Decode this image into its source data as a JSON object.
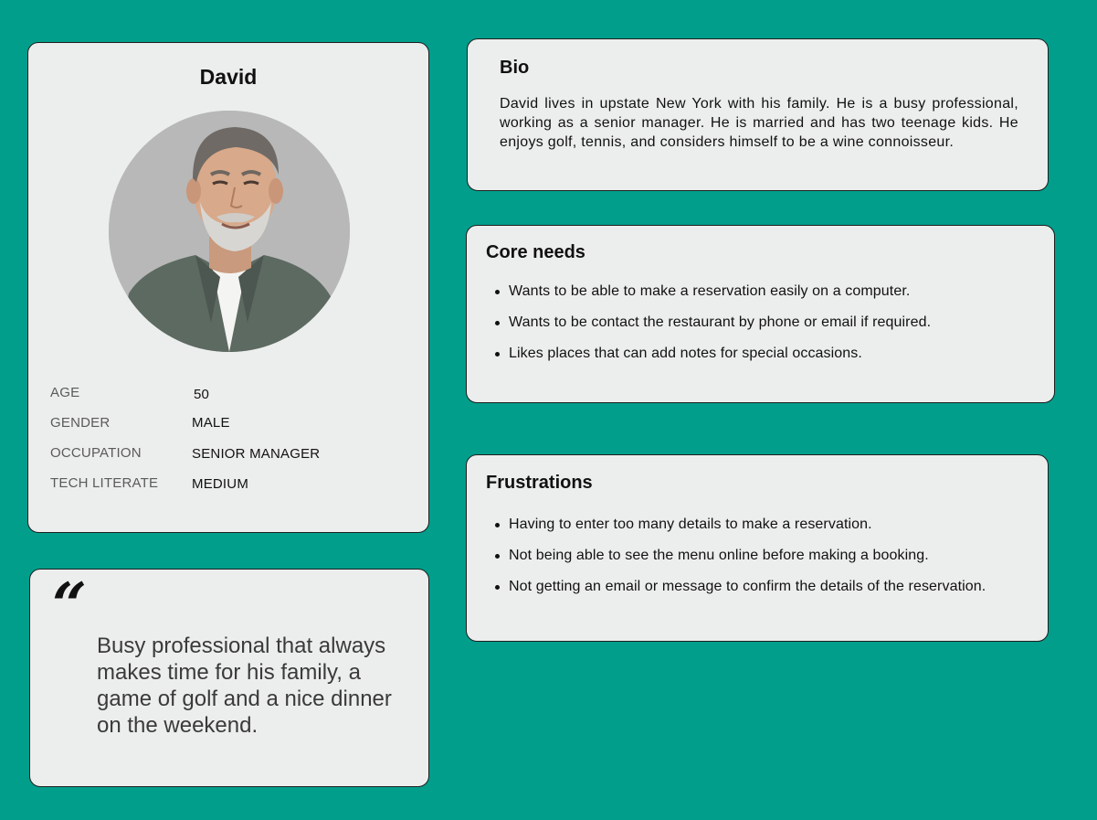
{
  "profile": {
    "name": "David",
    "attributes": [
      {
        "label": "AGE",
        "value": "50"
      },
      {
        "label": "GENDER",
        "value": "MALE"
      },
      {
        "label": "OCCUPATION",
        "value": "SENIOR MANAGER"
      },
      {
        "label": "TECH LITERATE",
        "value": "MEDIUM"
      }
    ]
  },
  "quote": {
    "mark": "“",
    "text": "Busy professional that always makes time for his family, a game of golf and a nice dinner on the weekend."
  },
  "bio": {
    "title": "Bio",
    "text": "David lives in upstate New York with his family. He is a busy professional, working as a senior manager. He is married and has two teenage kids. He enjoys golf, tennis, and considers himself to be a wine connoisseur."
  },
  "core_needs": {
    "title": "Core needs",
    "items": [
      "Wants to be able to make a reservation easily on a computer.",
      "Wants to be contact the restaurant by phone or email if required.",
      "Likes places that can add notes for special occasions."
    ]
  },
  "frustrations": {
    "title": "Frustrations",
    "items": [
      "Having to enter too many details to make a reservation.",
      "Not being able to see the menu online before making a booking.",
      "Not getting an email or message to confirm the details of the reservation."
    ]
  },
  "colors": {
    "background": "#019e8b",
    "card": "#eceeed",
    "border": "#1e1e1e"
  }
}
